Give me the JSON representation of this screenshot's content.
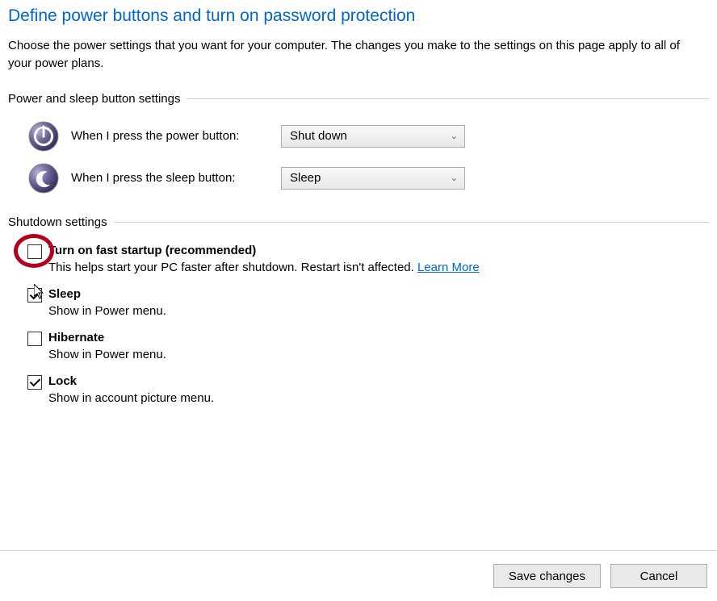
{
  "header": {
    "title": "Define power buttons and turn on password protection",
    "description": "Choose the power settings that you want for your computer. The changes you make to the settings on this page apply to all of your power plans."
  },
  "sections": {
    "button_settings_label": "Power and sleep button settings",
    "shutdown_label": "Shutdown settings"
  },
  "power_button": {
    "label": "When I press the power button:",
    "value": "Shut down"
  },
  "sleep_button": {
    "label": "When I press the sleep button:",
    "value": "Sleep"
  },
  "shutdown_items": {
    "fast_startup": {
      "title": "Turn on fast startup (recommended)",
      "desc": "This helps start your PC faster after shutdown. Restart isn't affected. ",
      "link": "Learn More",
      "checked": false
    },
    "sleep": {
      "title": "Sleep",
      "desc": "Show in Power menu.",
      "checked": true
    },
    "hibernate": {
      "title": "Hibernate",
      "desc": "Show in Power menu.",
      "checked": false
    },
    "lock": {
      "title": "Lock",
      "desc": "Show in account picture menu.",
      "checked": true
    }
  },
  "footer": {
    "save": "Save changes",
    "cancel": "Cancel"
  }
}
